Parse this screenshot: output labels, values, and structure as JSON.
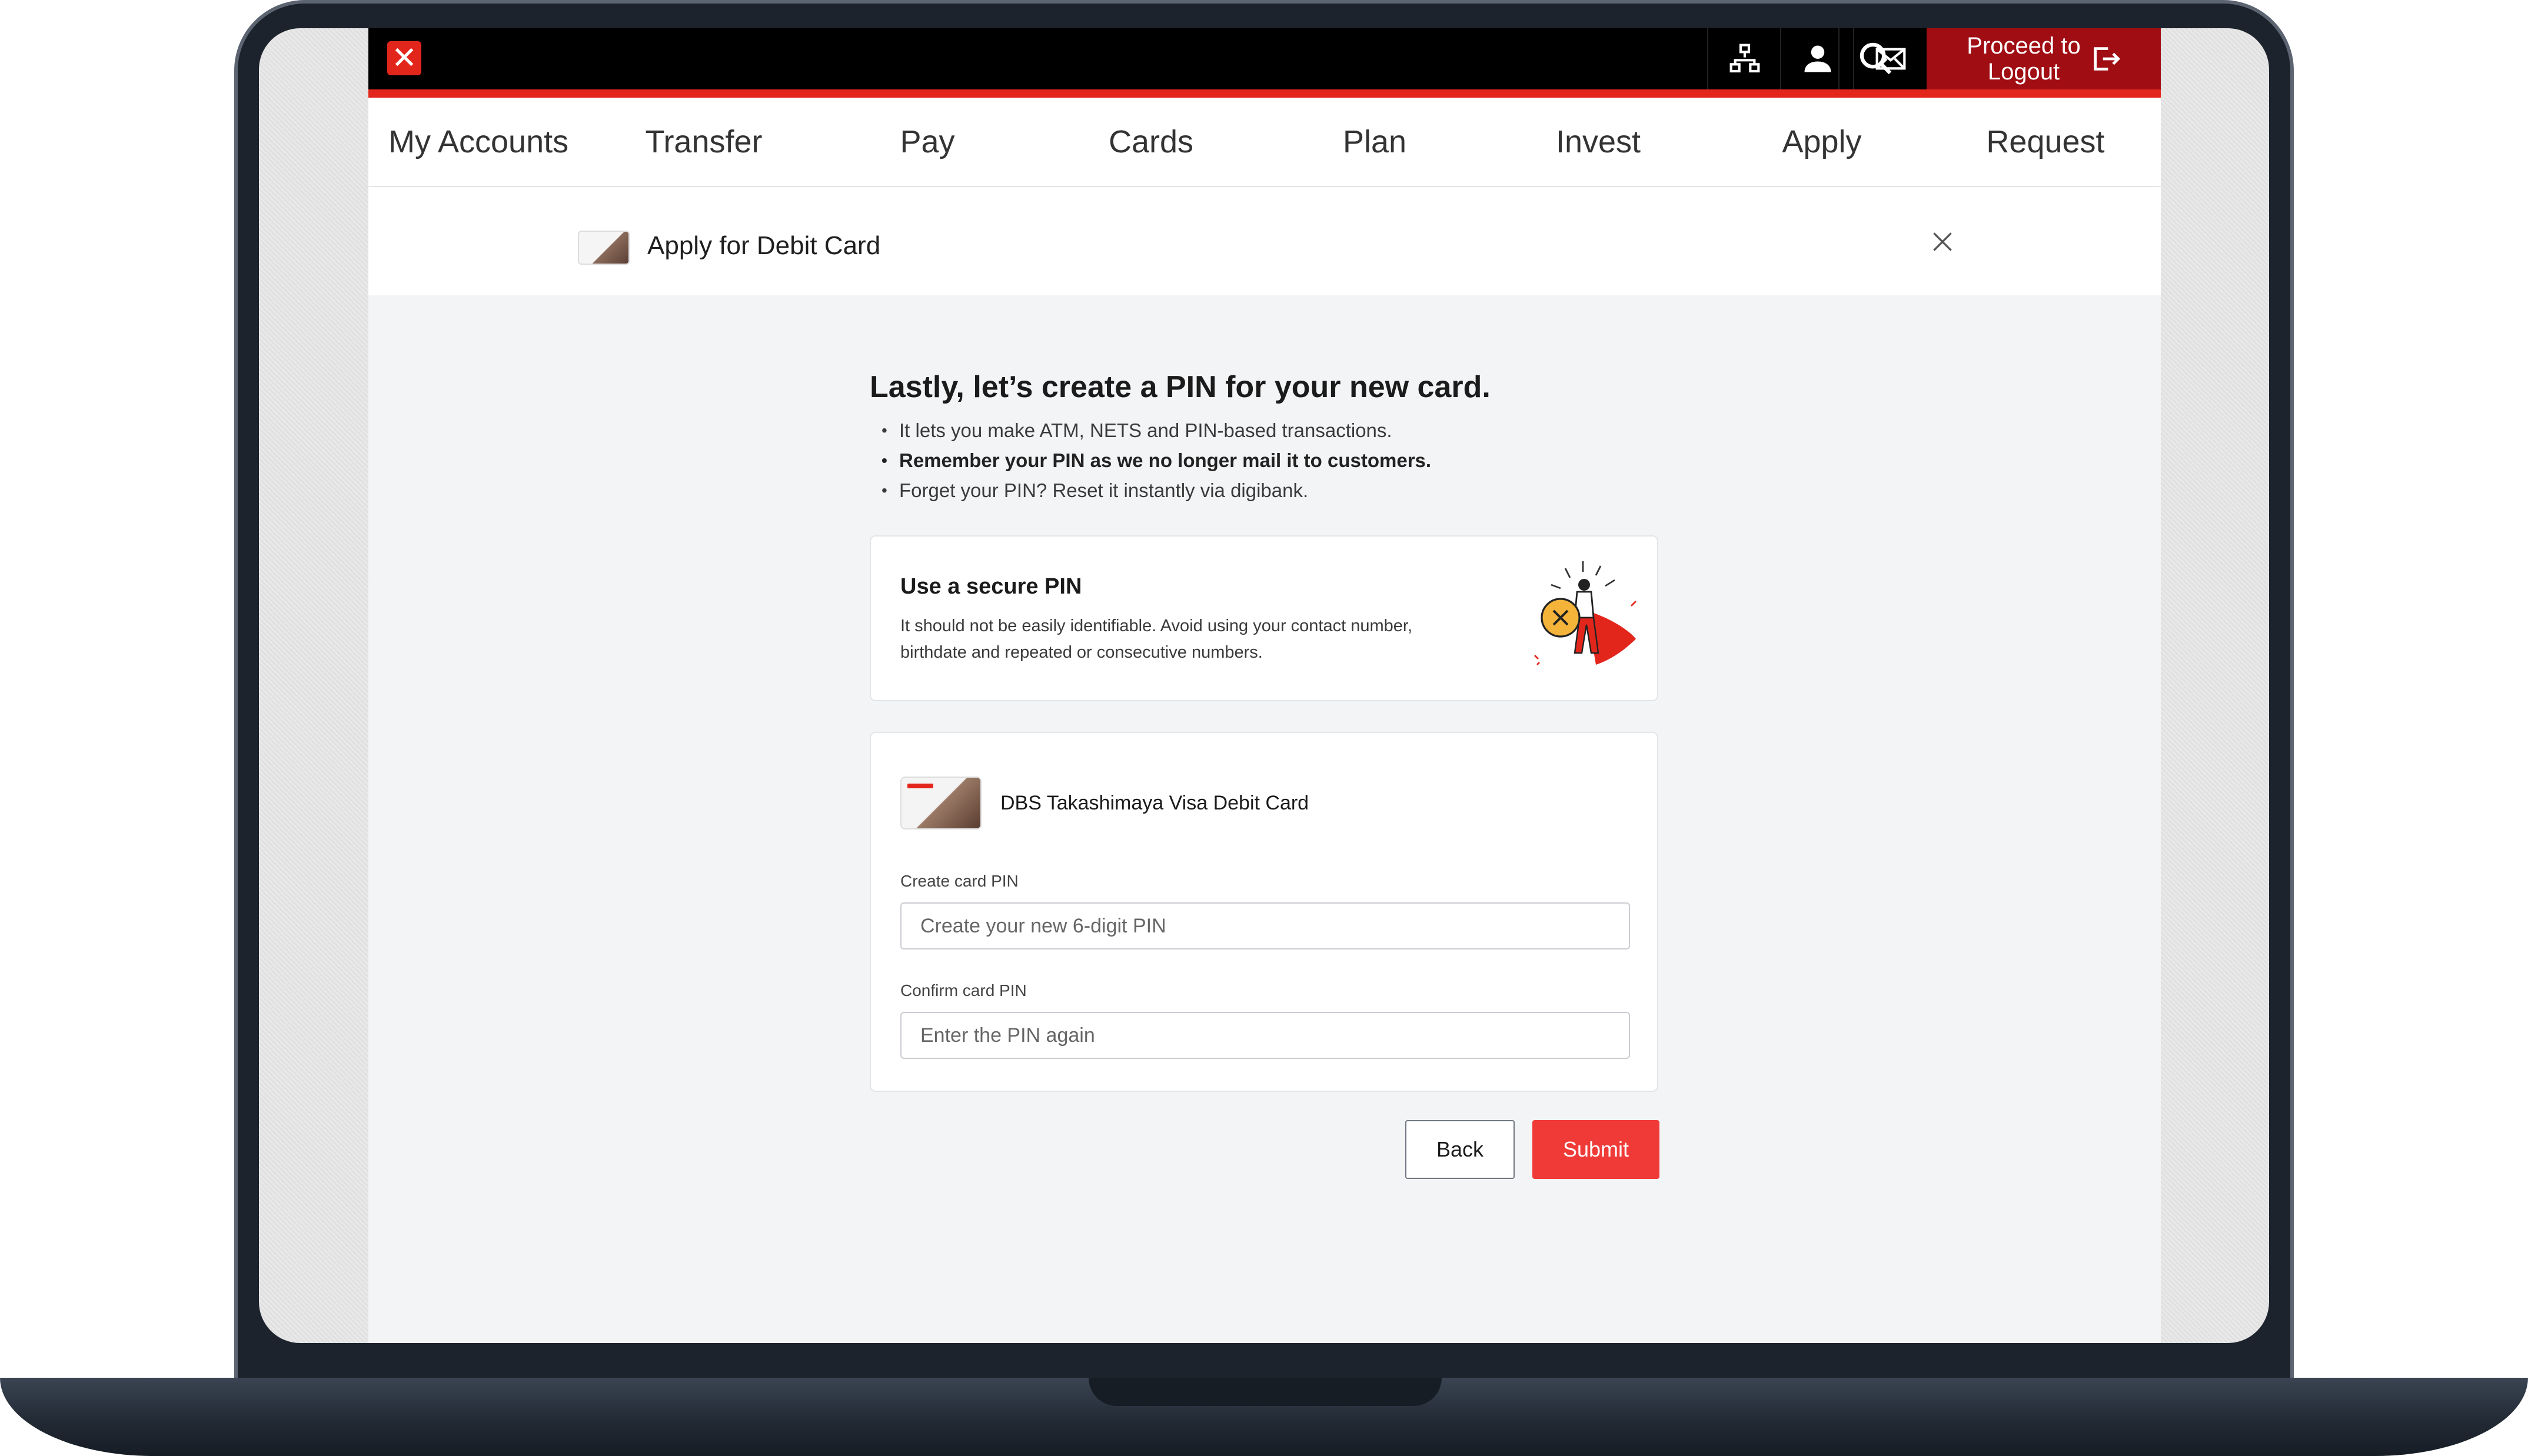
{
  "topbar": {
    "logout_line1": "Proceed to",
    "logout_line2": "Logout",
    "icons": [
      "sitemap-icon",
      "user-icon",
      "mail-icon",
      "search-icon"
    ],
    "brand_color": "#e3261c"
  },
  "nav": {
    "items": [
      "My Accounts",
      "Transfer",
      "Pay",
      "Cards",
      "Plan",
      "Invest",
      "Apply",
      "Request"
    ]
  },
  "subheader": {
    "title": "Apply for Debit Card"
  },
  "main": {
    "heading": "Lastly, let’s create a PIN for your new card.",
    "bullets": [
      "It lets you make ATM, NETS and PIN-based transactions.",
      "Remember your PIN as we no longer mail it to customers.",
      "Forget your PIN? Reset it instantly via digibank."
    ]
  },
  "secure_panel": {
    "title": "Use a secure PIN",
    "description": "It should not be easily identifiable. Avoid using your contact number, birthdate and repeated or consecutive numbers."
  },
  "card_panel": {
    "card_name": "DBS Takashimaya Visa Debit Card",
    "create_label": "Create card PIN",
    "create_placeholder": "Create your new 6-digit PIN",
    "confirm_label": "Confirm card PIN",
    "confirm_placeholder": "Enter the PIN again"
  },
  "actions": {
    "back": "Back",
    "submit": "Submit",
    "submit_color": "#f03a37"
  }
}
